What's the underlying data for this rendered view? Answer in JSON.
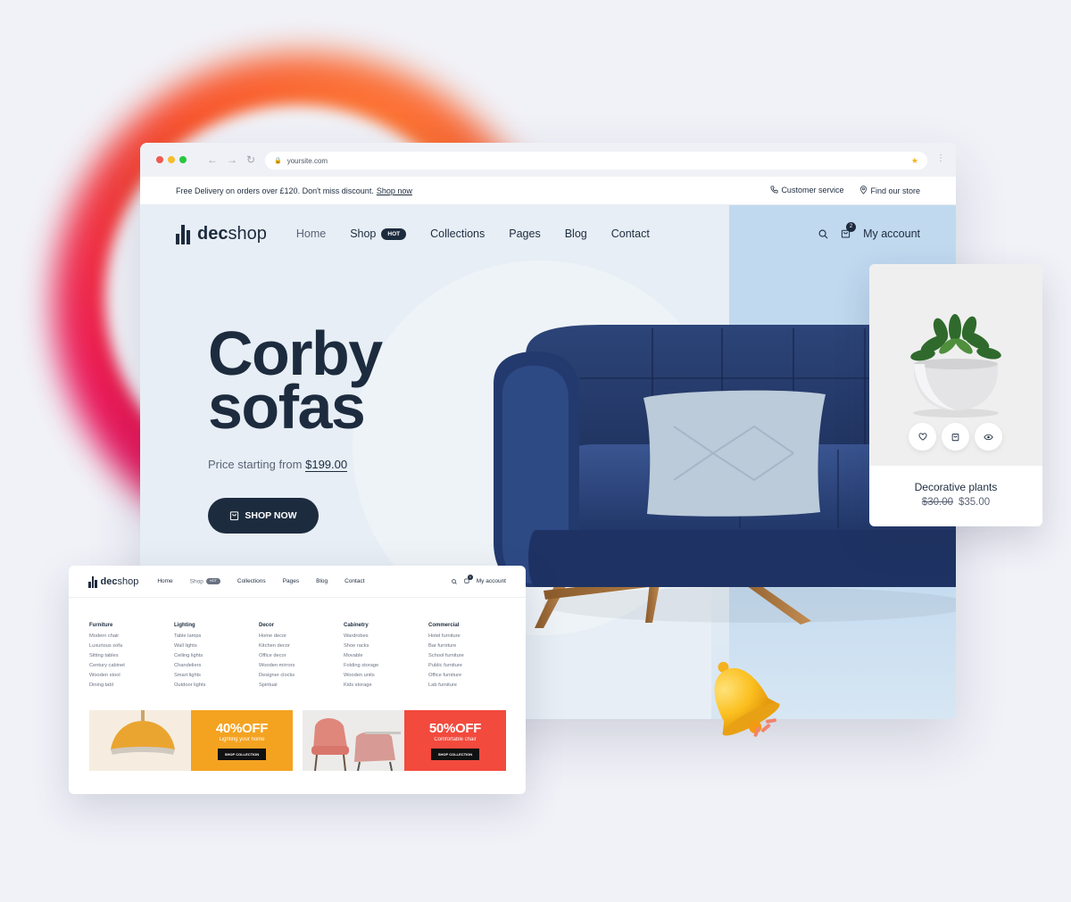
{
  "browser": {
    "url": "yoursite.com"
  },
  "topbar": {
    "notice": "Free Delivery on orders over £120. Don't miss discount.",
    "notice_link": "Shop now",
    "customer_service": "Customer service",
    "find_store": "Find our store"
  },
  "site": {
    "logo_bold": "dec",
    "logo_light": "shop",
    "nav": [
      "Home",
      "Shop",
      "Collections",
      "Pages",
      "Blog",
      "Contact"
    ],
    "hot_badge": "HOT",
    "cart_count": "2",
    "account": "My account"
  },
  "hero": {
    "title_line1": "Corby",
    "title_line2": "sofas",
    "price_prefix": "Price starting from",
    "price": "$199.00",
    "cta": "SHOP NOW"
  },
  "product_card": {
    "name": "Decorative plants",
    "old_price": "$30.00",
    "price": "$35.00"
  },
  "mega": {
    "logo_bold": "dec",
    "logo_light": "shop",
    "nav": [
      "Home",
      "Shop",
      "Collections",
      "Pages",
      "Blog",
      "Contact"
    ],
    "hot_badge": "HOT",
    "cart_count": "0",
    "account": "My account",
    "columns": [
      {
        "title": "Furniture",
        "items": [
          "Modern chair",
          "Luxurious sofa",
          "Sitting tables",
          "Century cabinet",
          "Wooden stool",
          "Dining tabl"
        ]
      },
      {
        "title": "Lighting",
        "items": [
          "Table lamps",
          "Wall lights",
          "Ceiling lights",
          "Chandeliers",
          "Smart lights",
          "Outdoor lights"
        ]
      },
      {
        "title": "Decor",
        "items": [
          "Home decor",
          "Kitchen decor",
          "Office decor",
          "Wooden mirrors",
          "Designer clocks",
          "Spiritual"
        ]
      },
      {
        "title": "Cabinetry",
        "items": [
          "Wardrobes",
          "Shoe racks",
          "Movable",
          "Folding storage",
          "Wooden units",
          "Kids storage"
        ]
      },
      {
        "title": "Commercial",
        "items": [
          "Hotel furniture",
          "Bar furniture",
          "School furniture",
          "Public furniture",
          "Office furniture",
          "Lab furniture"
        ]
      }
    ],
    "promos": [
      {
        "headline": "40%OFF",
        "subtitle": "Lighting your home",
        "button": "SHOP COLLECTION",
        "color": "#f4a321"
      },
      {
        "headline": "50%OFF",
        "subtitle": "Comfortable chair",
        "button": "SHOP COLLECTION",
        "color": "#f24a3d"
      }
    ]
  },
  "colors": {
    "primary": "#1d2b3e",
    "panel": "#c0d9ef",
    "promo_orange": "#f4a321",
    "promo_red": "#f24a3d"
  }
}
